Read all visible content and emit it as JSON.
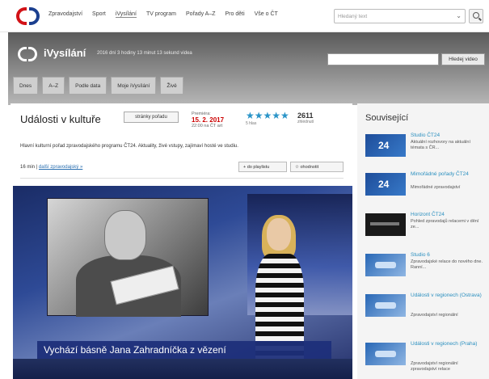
{
  "topnav": {
    "items": [
      "Zpravodajství",
      "Sport",
      "iVysílání",
      "TV program",
      "Pořady A–Z",
      "Pro děti",
      "Vše o ČT"
    ],
    "active": "iVysílání",
    "search_placeholder": "Hledaný text"
  },
  "header": {
    "title": "iVysílání",
    "stats": "2016 dní 3 hodiny 13 minut 13 sekund videa",
    "search_button": "Hledej video",
    "tabs": [
      "Dnes",
      "A–Z",
      "Podle data",
      "Moje iVysílání",
      "Živě"
    ]
  },
  "program": {
    "title": "Události v kultuře",
    "page_button": "stránky pořadu",
    "premiere_label": "Premiéra:",
    "premiere_date": "15. 2. 2017",
    "premiere_time": "22:00 na ČT art",
    "rating_stars": "★★★★★",
    "rating_label": "5 hlas",
    "views": "2611",
    "views_label": "zhlédnutí",
    "description": "Hlavní kulturní pořad zpravodajského programu ČT24. Aktuality, živé vstupy, zajímaví hosté ve studiu.",
    "duration": "16 min",
    "episodes_link": "další zpravodajský »",
    "playlist_button": "do playlistu",
    "rate_button": "ohodnotit"
  },
  "video": {
    "caption": "Vychází básně Jana Zahradníčka z vězení"
  },
  "sidebar": {
    "title": "Související",
    "items": [
      {
        "title": "Studio ČT24",
        "desc": "Aktuální rozhovory na aktuální témata s ČR...",
        "thumb": "24"
      },
      {
        "title": "Mimořádné pořady ČT24",
        "desc": "Mimořádné zpravodajství",
        "thumb": "24"
      },
      {
        "title": "Horizont ČT24",
        "desc": "Pohled zpravodajů relacemi v dění ze...",
        "thumb": ""
      },
      {
        "title": "Studio 6",
        "desc": "Zpravodajské relace do nového dne. Ranní...",
        "thumb": ""
      },
      {
        "title": "Události v regionech (Ostrava)",
        "desc": "Zpravodajství regionální",
        "thumb": ""
      },
      {
        "title": "Události v regionech (Praha)",
        "desc": "Zpravodajství regionální zpravodajství relace",
        "thumb": ""
      }
    ]
  },
  "colors": {
    "brand_red": "#d21217",
    "brand_blue": "#1b3f8f",
    "link_blue": "#2a8fbf",
    "caption_bar": "#1d2f7a"
  }
}
